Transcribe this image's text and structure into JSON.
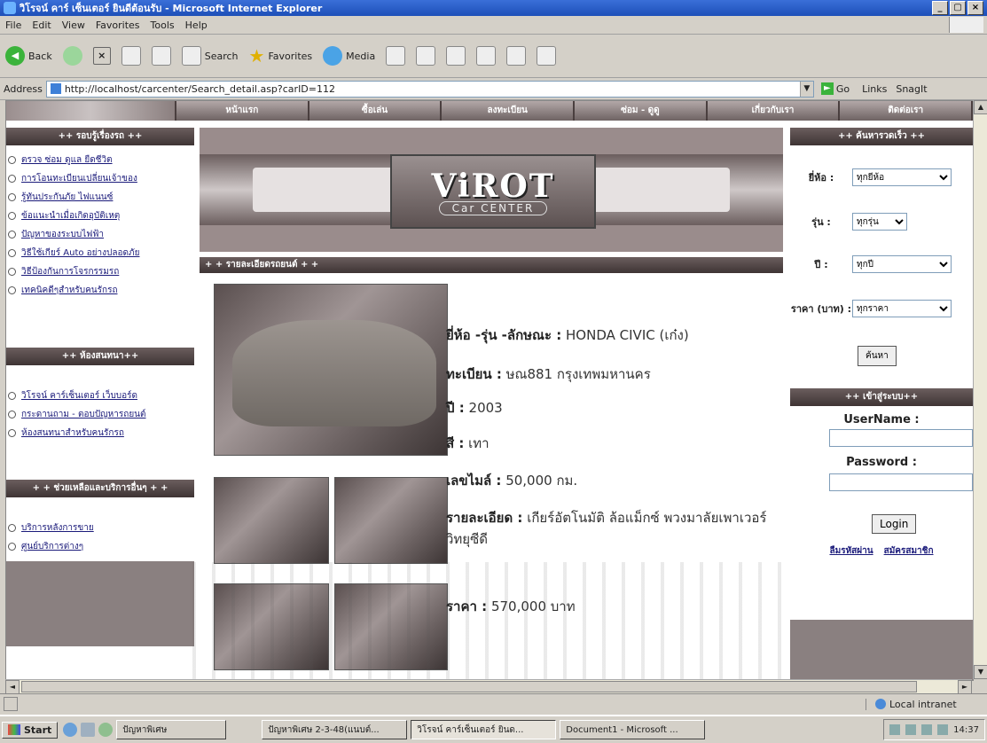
{
  "window": {
    "title": "วิโรจน์ คาร์ เซ็นเตอร์ ยินดีต้อนรับ - Microsoft Internet Explorer",
    "controls": [
      "_",
      "▢",
      "×"
    ]
  },
  "menu": [
    "File",
    "Edit",
    "View",
    "Favorites",
    "Tools",
    "Help"
  ],
  "toolbar": {
    "back": "Back",
    "search": "Search",
    "favorites": "Favorites",
    "media": "Media"
  },
  "address": {
    "label": "Address",
    "url": "http://localhost/carcenter/Search_detail.asp?carID=112",
    "go": "Go",
    "links": "Links",
    "snagit": "SnagIt"
  },
  "nav_tabs": [
    "หน้าแรก",
    "ซื้อเล่น",
    "ลงทะเบียน",
    "ซ่อม - ดูดู",
    "เกี่ยวกับเรา",
    "ติดต่อเรา"
  ],
  "left": {
    "sections": [
      {
        "title": "++ รอบรู้เรื่องรถ ++",
        "items": [
          "ตรวจ ซ่อม ดูแล ยืดชีวิต",
          "การโอนทะเบียนเปลี่ยนเจ้าของ",
          "รู้ทันประกันภัย ไฟแนนซ์",
          "ข้อแนะนำเมื่อเกิดอุบัติเหตุ",
          "ปัญหาของระบบไฟฟ้า",
          "วิธีใช้เกียร์ Auto อย่างปลอดภัย",
          "วิธีป้องกันการโจรกรรมรถ",
          "เทคนิคดีๆสำหรับคนรักรถ"
        ]
      },
      {
        "title": "++ ห้องสนทนา++",
        "items": [
          "วิโรจน์ คาร์เซ็นเตอร์ เว็บบอร์ด",
          "กระดานถาม - ตอบปัญหารถยนต์",
          "ห้องสนทนาสำหรับคนรักรถ"
        ]
      },
      {
        "title": "+ + ช่วยเหลือและบริการอื่นๆ + +",
        "items": [
          "บริการหลังการขาย",
          "ศูนย์บริการต่างๆ"
        ]
      }
    ]
  },
  "banner": {
    "logo_main": "ViROT",
    "logo_sub": "Car CENTER"
  },
  "detail": {
    "header": "+ + รายละเอียดรถยนต์ + +",
    "brand_label": "ยี่ห้อ -รุ่น -ลักษณะ :",
    "brand_value": "HONDA CIVIC (เก๋ง)",
    "reg_label": "ทะเบียน :",
    "reg_value": "ษณ881 กรุงเทพมหานคร",
    "year_label": "ปี :",
    "year_value": "2003",
    "color_label": "สี :",
    "color_value": "เทา",
    "mileage_label": "เลขไมล์ :",
    "mileage_value": "50,000 กม.",
    "desc_label": "รายละเอียด :",
    "desc_value": "เกียร์อัตโนมัติ ล้อแม็กซ์ พวงมาลัยเพาเวอร์ วิทยุซีดี",
    "price_label": "ราคา :",
    "price_value": "570,000 บาท"
  },
  "quick_search": {
    "title": "++ ค้นหารวดเร็ว ++",
    "brand_label": "ยี่ห้อ :",
    "brand_value": "ทุกยี่ห้อ",
    "model_label": "รุ่น :",
    "model_value": "ทุกรุ่น",
    "year_label": "ปี :",
    "year_value": "ทุกปี",
    "price_label": "ราคา (บาท) :",
    "price_value": "ทุกราคา",
    "search_button": "ค้นหา"
  },
  "login": {
    "title": "++ เข้าสู่ระบบ++",
    "username_label": "UserName :",
    "password_label": "Password :",
    "login_button": "Login",
    "forgot": "ลืมรหัสผ่าน",
    "register": "สมัครสมาชิก"
  },
  "status": {
    "zone": "Local intranet"
  },
  "taskbar": {
    "start": "Start",
    "tasks": [
      "ปัญหาพิเศษ",
      "ปัญหาพิเศษ 2-3-48(แนบต์...",
      "วิโรจน์ คาร์เซ็นเตอร์ ยินด...",
      "Document1 - Microsoft ..."
    ],
    "clock": "14:37"
  },
  "colors": {
    "header_bg": "#3e3434",
    "nav_bg": "#6e6363",
    "link": "#1a1a7a"
  }
}
